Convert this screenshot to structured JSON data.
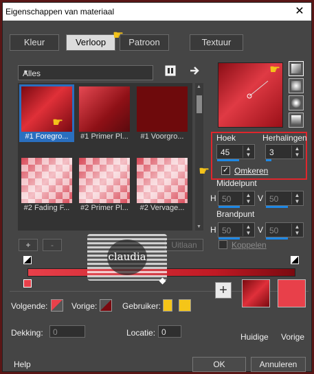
{
  "window": {
    "title": "Eigenschappen van materiaal",
    "close_glyph": "✕"
  },
  "tabs": [
    {
      "label": "Kleur",
      "active": false
    },
    {
      "label": "Verloop",
      "active": true
    },
    {
      "label": "Patroon",
      "active": false
    },
    {
      "label": "Textuur",
      "active": false
    }
  ],
  "category_select": {
    "value": "Alles"
  },
  "gallery": [
    {
      "label": "#1 Foregro...",
      "selected": true
    },
    {
      "label": "#1 Primer Pl...",
      "selected": false
    },
    {
      "label": "#1 Voorgro...",
      "selected": false
    },
    {
      "label": "#2 Fading F...",
      "selected": false
    },
    {
      "label": "#2 Primer Pl...",
      "selected": false
    },
    {
      "label": "#2 Vervage...",
      "selected": false
    }
  ],
  "settings": {
    "hoek_label": "Hoek",
    "hoek_value": "45",
    "herhalingen_label": "Herhalingen",
    "herhalingen_value": "3",
    "omkeren_label": "Omkeren",
    "omkeren_checked": true,
    "middelpunt_label": "Middelpunt",
    "middelpunt_h": "50",
    "middelpunt_v": "50",
    "brandpunt_label": "Brandpunt",
    "brandpunt_h": "50",
    "brandpunt_v": "50",
    "koppelen_label": "Koppelen",
    "h_label": "H",
    "v_label": "V"
  },
  "editor": {
    "add_label": "+",
    "remove_label": "-",
    "keep_label": "Uitlaan"
  },
  "watermark": {
    "name": "claudia"
  },
  "colors": {
    "volgende_label": "Volgende:",
    "vorige_label": "Vorige:",
    "gebruiker_label": "Gebruiker:",
    "volgende_color": "#e8404a",
    "vorige_color": "#7a0a10",
    "gebruiker_color": "#f5c518",
    "accent": "#e0262c"
  },
  "stop_fields": {
    "dekking_label": "Dekking:",
    "dekking_value": "0",
    "locatie_label": "Locatie:",
    "locatie_value": "0"
  },
  "swatches": {
    "plus_label": "+",
    "huidige_label": "Huidige",
    "vorige_label": "Vorige"
  },
  "footer": {
    "help_label": "Help",
    "ok_label": "OK",
    "cancel_label": "Annuleren"
  },
  "icons": [
    "close-icon",
    "browse-icon",
    "arrow-right-icon",
    "chevron-down-icon",
    "spin-up-icon",
    "spin-down-icon",
    "pointing-hand-icon",
    "linear-style-icon",
    "rectangular-style-icon",
    "radial-style-icon",
    "sunburst-style-icon"
  ]
}
